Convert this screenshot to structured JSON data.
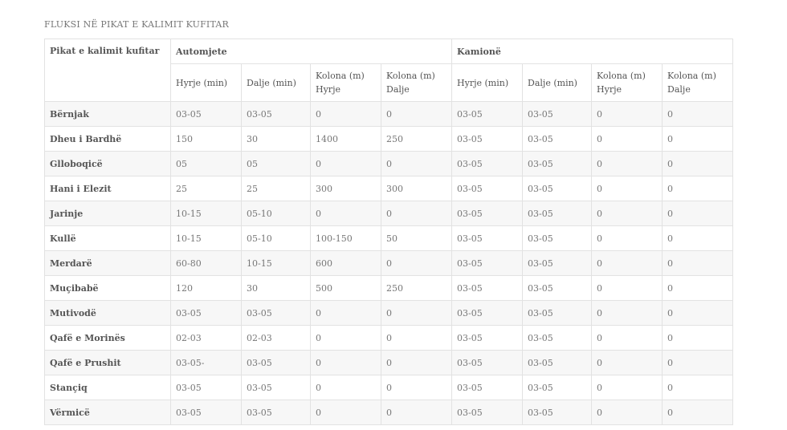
{
  "caption": "FLUKSI NË PIKAT E KALIMIT KUFITAR",
  "table": {
    "corner_header": "Pikat e kalimit kufitar",
    "groups": [
      "Automjete",
      "Kamionë"
    ],
    "columns": [
      "Hyrje (min)",
      "Dalje (min)",
      "Kolona (m) Hyrje",
      "Kolona (m) Dalje",
      "Hyrje (min)",
      "Dalje (min)",
      "Kolona (m) Hyrje",
      "Kolona (m) Dalje"
    ],
    "rows": [
      {
        "name": "Bërnjak",
        "cells": [
          "03-05",
          "03-05",
          "0",
          "0",
          "03-05",
          "03-05",
          "0",
          "0"
        ]
      },
      {
        "name": "Dheu i Bardhë",
        "cells": [
          "150",
          "30",
          "1400",
          "250",
          "03-05",
          "03-05",
          "0",
          "0"
        ]
      },
      {
        "name": "Glloboqicë",
        "cells": [
          "05",
          "05",
          "0",
          "0",
          "03-05",
          "03-05",
          "0",
          "0"
        ]
      },
      {
        "name": "Hani i Elezit",
        "cells": [
          "25",
          "25",
          "300",
          "300",
          "03-05",
          "03-05",
          "0",
          "0"
        ]
      },
      {
        "name": "Jarinje",
        "cells": [
          "10-15",
          "05-10",
          "0",
          "0",
          "03-05",
          "03-05",
          "0",
          "0"
        ]
      },
      {
        "name": "Kullë",
        "cells": [
          "10-15",
          "05-10",
          "100-150",
          "50",
          "03-05",
          "03-05",
          "0",
          "0"
        ]
      },
      {
        "name": "Merdarë",
        "cells": [
          "60-80",
          "10-15",
          "600",
          "0",
          "03-05",
          "03-05",
          "0",
          "0"
        ]
      },
      {
        "name": "Muçibabë",
        "cells": [
          "120",
          "30",
          "500",
          "250",
          "03-05",
          "03-05",
          "0",
          "0"
        ]
      },
      {
        "name": "Mutivodë",
        "cells": [
          "03-05",
          "03-05",
          "0",
          "0",
          "03-05",
          "03-05",
          "0",
          "0"
        ]
      },
      {
        "name": "Qafë e Morinës",
        "cells": [
          "02-03",
          "02-03",
          "0",
          "0",
          "03-05",
          "03-05",
          "0",
          "0"
        ]
      },
      {
        "name": "Qafë e Prushit",
        "cells": [
          "03-05-",
          "03-05",
          "0",
          "0",
          "03-05",
          "03-05",
          "0",
          "0"
        ]
      },
      {
        "name": "Stançiq",
        "cells": [
          "03-05",
          "03-05",
          "0",
          "0",
          "03-05",
          "03-05",
          "0",
          "0"
        ]
      },
      {
        "name": "Vërmicë",
        "cells": [
          "03-05",
          "03-05",
          "0",
          "0",
          "03-05",
          "03-05",
          "0",
          "0"
        ]
      }
    ]
  }
}
